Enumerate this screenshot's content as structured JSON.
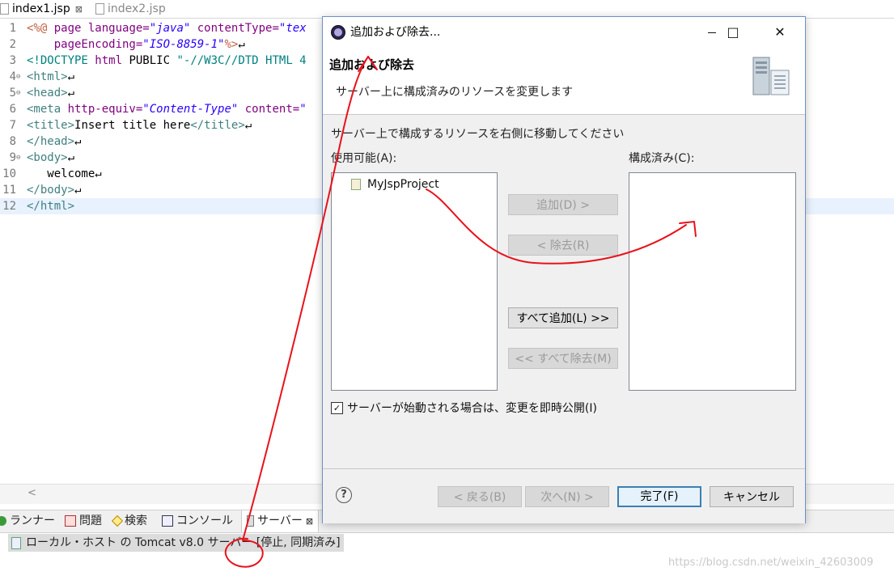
{
  "editor": {
    "tabs": [
      {
        "label": "index1.jsp",
        "close": "⊠"
      },
      {
        "label": "index2.jsp"
      }
    ],
    "lines": [
      {
        "n": "1",
        "fold": "",
        "parts": [
          [
            "jsp",
            "<%@ "
          ],
          [
            "attr",
            "page "
          ],
          [
            "attr",
            "language="
          ],
          [
            "str",
            "\"java\""
          ],
          [
            "txt",
            " "
          ],
          [
            "attr",
            "contentType="
          ],
          [
            "str",
            "\"tex"
          ]
        ]
      },
      {
        "n": "2",
        "fold": "",
        "parts": [
          [
            "txt",
            "    "
          ],
          [
            "attr",
            "pageEncoding="
          ],
          [
            "str",
            "\"ISO-8859-1\""
          ],
          [
            "jsp",
            "%>"
          ],
          [
            "txt",
            "↵"
          ]
        ]
      },
      {
        "n": "3",
        "fold": "",
        "parts": [
          [
            "doc",
            "<!DOCTYPE "
          ],
          [
            "attr",
            "html "
          ],
          [
            "txt",
            "PUBLIC "
          ],
          [
            "doc",
            "\"-//W3C//DTD HTML 4"
          ]
        ]
      },
      {
        "n": "4",
        "fold": "⊖",
        "parts": [
          [
            "tag",
            "<html>"
          ],
          [
            "txt",
            "↵"
          ]
        ]
      },
      {
        "n": "5",
        "fold": "⊖",
        "parts": [
          [
            "tag",
            "<head>"
          ],
          [
            "txt",
            "↵"
          ]
        ]
      },
      {
        "n": "6",
        "fold": "",
        "parts": [
          [
            "tag",
            "<meta "
          ],
          [
            "attr",
            "http-equiv="
          ],
          [
            "str",
            "\"Content-Type\""
          ],
          [
            "txt",
            " "
          ],
          [
            "attr",
            "content="
          ],
          [
            "str",
            "\""
          ]
        ]
      },
      {
        "n": "7",
        "fold": "",
        "parts": [
          [
            "tag",
            "<title>"
          ],
          [
            "txt",
            "Insert title here"
          ],
          [
            "tag",
            "</title>"
          ],
          [
            "txt",
            "↵"
          ]
        ]
      },
      {
        "n": "8",
        "fold": "",
        "parts": [
          [
            "tag",
            "</head>"
          ],
          [
            "txt",
            "↵"
          ]
        ]
      },
      {
        "n": "9",
        "fold": "⊖",
        "parts": [
          [
            "tag",
            "<body>"
          ],
          [
            "txt",
            "↵"
          ]
        ]
      },
      {
        "n": "10",
        "fold": "",
        "parts": [
          [
            "txt",
            "   welcome↵"
          ]
        ]
      },
      {
        "n": "11",
        "fold": "",
        "parts": [
          [
            "tag",
            "</body>"
          ],
          [
            "txt",
            "↵"
          ]
        ]
      },
      {
        "n": "12",
        "fold": "",
        "parts": [
          [
            "tag",
            "</html>"
          ]
        ]
      }
    ],
    "current_line": "12",
    "scroll_arrow": "<"
  },
  "views": {
    "tabs": [
      {
        "label": "ランナー",
        "icon": "runner-icon"
      },
      {
        "label": "問題",
        "icon": "problems-icon"
      },
      {
        "label": "検索",
        "icon": "search-icon"
      },
      {
        "label": "コンソール",
        "icon": "console-icon"
      },
      {
        "label": "サーバー",
        "icon": "servers-icon",
        "close": "⊠"
      }
    ],
    "server_entry": "ローカル・ホスト の Tomcat v8.0 サーバー  [停止, 同期済み]"
  },
  "watermark": "https://blog.csdn.net/weixin_42603009",
  "dialog": {
    "title": "追加および除去...",
    "window_buttons": {
      "minimize": "",
      "maximize": "□",
      "close": "✕"
    },
    "header_title": "追加および除去",
    "header_desc": "サーバー上に構成済みのリソースを変更します",
    "instruction": "サーバー上で構成するリソースを右側に移動してください",
    "available_label": "使用可能(A):",
    "configured_label": "構成済み(C):",
    "available_items": [
      "MyJspProject"
    ],
    "configured_items": [],
    "buttons": {
      "add": "追加(D) >",
      "remove": "< 除去(R)",
      "add_all": "すべて追加(L) >>",
      "remove_all": "<< すべて除去(M)"
    },
    "checkbox_label": "サーバーが始動される場合は、変更を即時公開(I)",
    "checkbox_checked": true,
    "checkbox_mark": "✓",
    "footer": {
      "help": "?",
      "back": "< 戻る(B)",
      "next": "次へ(N) >",
      "finish": "完了(F)",
      "cancel": "キャンセル"
    }
  },
  "colors": {
    "annotation": "#e8121b",
    "dialog_border": "#6d8fc6",
    "current_line": "#e8f2fe"
  }
}
